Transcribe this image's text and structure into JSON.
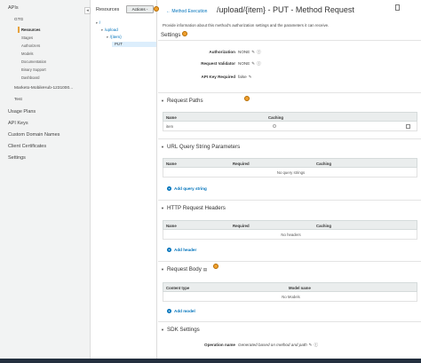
{
  "nav": {
    "apis": "APIs",
    "gtg": "GTG",
    "resources": "Resources",
    "stages": "Stages",
    "authorizers": "Authorizers",
    "models": "Models",
    "documentation": "Documentation",
    "binary_support": "Binary Support",
    "dashboard": "Dashboard",
    "other_api": "Marketo-MobileHub-1231000...",
    "test": "Test",
    "usage_plans": "Usage Plans",
    "api_keys": "API Keys",
    "custom_domain_names": "Custom Domain Names",
    "client_certificates": "Client Certificates",
    "settings": "Settings"
  },
  "resources_panel": {
    "title": "Resources",
    "actions_label": "Actions -",
    "tree": [
      "/",
      "/upload",
      "/{item}",
      "PUT"
    ]
  },
  "main": {
    "back_link": "Method Execution",
    "title": "/upload/{item} - PUT - Method Request",
    "description": "Provide information about this method's authorization settings and the parameters it can receive.",
    "settings": {
      "heading": "Settings",
      "authorization_label": "Authorization",
      "authorization_value": "NONE",
      "request_validator_label": "Request Validator",
      "request_validator_value": "NONE",
      "api_key_label": "API Key Required",
      "api_key_value": "false"
    },
    "request_paths": {
      "heading": "Request Paths",
      "columns": [
        "Name",
        "Caching"
      ],
      "rows": [
        {
          "name": "item"
        }
      ]
    },
    "query_strings": {
      "heading": "URL Query String Parameters",
      "columns": [
        "Name",
        "Required",
        "Caching"
      ],
      "empty": "No query strings",
      "add_label": "Add query string"
    },
    "headers": {
      "heading": "HTTP Request Headers",
      "columns": [
        "Name",
        "Required",
        "Caching"
      ],
      "empty": "No headers",
      "add_label": "Add header"
    },
    "body": {
      "heading": "Request Body",
      "columns": [
        "Content type",
        "Model name"
      ],
      "empty": "No Models",
      "add_label": "Add model"
    },
    "sdk": {
      "heading": "SDK Settings",
      "operation_label": "Operation name",
      "operation_value": "Generated based on method and path"
    }
  },
  "icons": {
    "edit": "pencil-icon",
    "info": "info-icon",
    "delete": "trash-icon",
    "badge": "notification-badge"
  },
  "colors": {
    "link": "#0073bb",
    "badge": "#f0a030",
    "nav_bg": "#f2f3f3"
  }
}
